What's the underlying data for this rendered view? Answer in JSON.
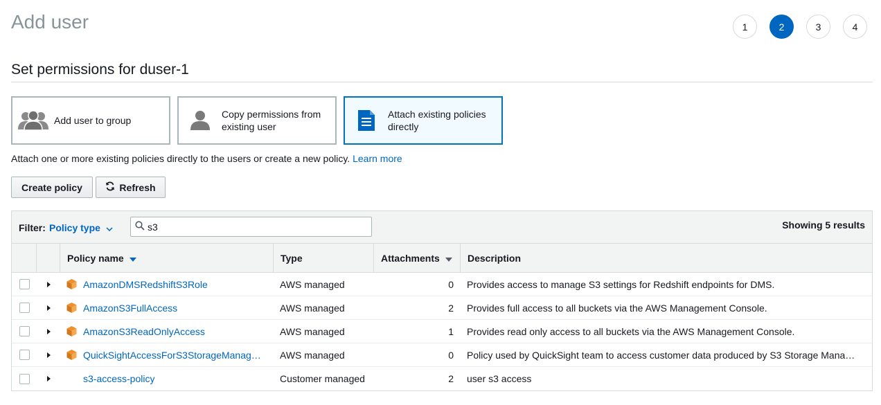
{
  "header": {
    "title": "Add user"
  },
  "steps": [
    "1",
    "2",
    "3",
    "4"
  ],
  "active_step": "2",
  "section": {
    "title": "Set permissions for duser-1"
  },
  "options": [
    {
      "label": "Add user to group",
      "icon": "users-group-icon",
      "selected": false
    },
    {
      "label": "Copy permissions from existing user",
      "icon": "user-icon",
      "selected": false
    },
    {
      "label": "Attach existing policies directly",
      "icon": "document-icon",
      "selected": true
    }
  ],
  "description": {
    "text": "Attach one or more existing policies directly to the users or create a new policy.",
    "link": "Learn more"
  },
  "buttons": {
    "create_policy": "Create policy",
    "refresh": "Refresh"
  },
  "filter": {
    "label": "Filter:",
    "type": "Policy type",
    "search_value": "s3",
    "showing": "Showing 5 results"
  },
  "table": {
    "columns": {
      "name": "Policy name",
      "type": "Type",
      "attachments": "Attachments",
      "description": "Description"
    },
    "rows": [
      {
        "name": "AmazonDMSRedshiftS3Role",
        "type": "AWS managed",
        "attachments": "0",
        "description": "Provides access to manage S3 settings for Redshift endpoints for DMS.",
        "aws_icon": true
      },
      {
        "name": "AmazonS3FullAccess",
        "type": "AWS managed",
        "attachments": "2",
        "description": "Provides full access to all buckets via the AWS Management Console.",
        "aws_icon": true
      },
      {
        "name": "AmazonS3ReadOnlyAccess",
        "type": "AWS managed",
        "attachments": "1",
        "description": "Provides read only access to all buckets via the AWS Management Console.",
        "aws_icon": true
      },
      {
        "name": "QuickSightAccessForS3StorageManag…",
        "type": "AWS managed",
        "attachments": "0",
        "description": "Policy used by QuickSight team to access customer data produced by S3 Storage Mana…",
        "aws_icon": true
      },
      {
        "name": "s3-access-policy",
        "type": "Customer managed",
        "attachments": "2",
        "description": "user s3 access",
        "aws_icon": false
      }
    ]
  },
  "colors": {
    "link": "#0066c0",
    "active_step": "#0066c0",
    "aws_icon": "#ec912d",
    "selected_border": "#0073bb"
  }
}
